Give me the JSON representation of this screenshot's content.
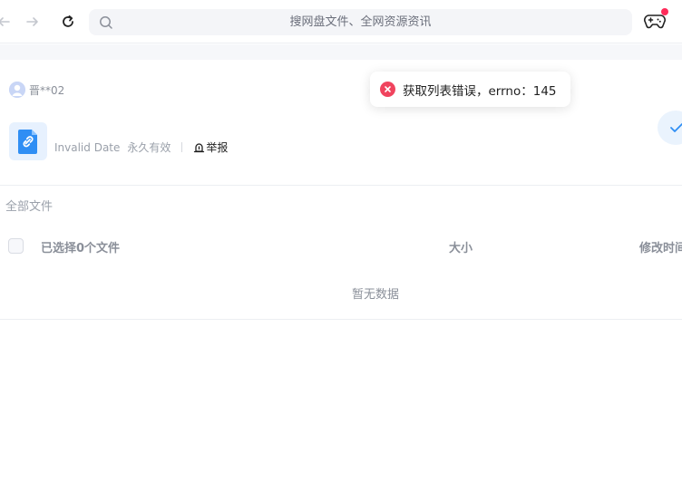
{
  "search": {
    "placeholder": "搜网盘文件、全网资源资讯"
  },
  "share": {
    "owner": "晋**02",
    "date": "Invalid Date",
    "validity": "永久有效",
    "report_label": "举报"
  },
  "files": {
    "breadcrumb": "全部文件",
    "selected_label": "已选择0个文件",
    "col_size": "大小",
    "col_modified": "修改时间",
    "empty_text": "暂无数据"
  },
  "toast": {
    "message": "获取列表错误，errno：145"
  },
  "icons": {
    "back": "arrow-left-icon",
    "forward": "arrow-right-icon",
    "refresh": "refresh-icon",
    "search": "search-icon",
    "game": "gamepad-icon",
    "file": "link-file-icon",
    "report": "report-icon",
    "error": "error-circle-icon",
    "check": "check-icon"
  },
  "colors": {
    "accent": "#2f8ef4",
    "error": "#f0445e",
    "notification": "#ff2b5a"
  }
}
